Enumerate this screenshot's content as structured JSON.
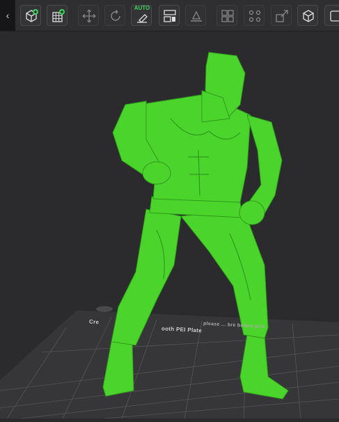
{
  "toolbar": {
    "collapse_glyph": "‹",
    "auto_label": "AUTO",
    "accent_color": "#41d35f",
    "tools": [
      {
        "name": "add-object",
        "icon": "cube-plus-icon"
      },
      {
        "name": "add-plate",
        "icon": "grid-plus-icon"
      },
      {
        "name": "move",
        "icon": "move-arrows-icon"
      },
      {
        "name": "rotate",
        "icon": "rotate-icon"
      },
      {
        "name": "auto-orient",
        "icon": "auto-orient-icon"
      },
      {
        "name": "arrange",
        "icon": "arrange-icon"
      },
      {
        "name": "lay-on-face",
        "icon": "lay-on-face-icon"
      },
      {
        "name": "split-objects",
        "icon": "split-objects-icon"
      },
      {
        "name": "split-parts",
        "icon": "split-parts-icon"
      },
      {
        "name": "scale",
        "icon": "scale-icon"
      },
      {
        "name": "cut",
        "icon": "cut-icon"
      },
      {
        "name": "more",
        "icon": "more-icon"
      }
    ]
  },
  "viewport": {
    "model_color": "#4bd52c",
    "plate_label_left": "Cre",
    "plate_label_mid": "ooth PEI Plate",
    "plate_label_right": "please ... bre before prin"
  }
}
